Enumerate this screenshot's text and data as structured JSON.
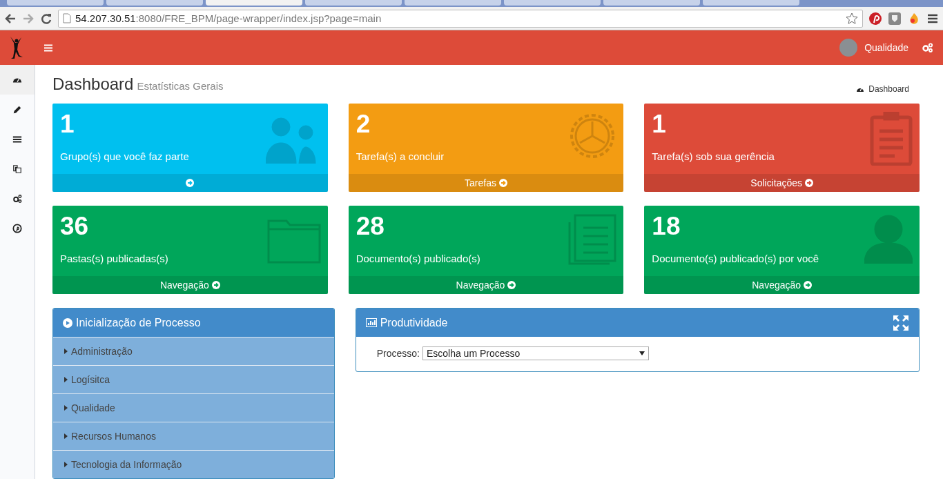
{
  "browser": {
    "tabs": [
      {
        "selected": false
      },
      {
        "selected": false
      },
      {
        "selected": true
      },
      {
        "selected": false
      },
      {
        "selected": false
      },
      {
        "selected": false
      },
      {
        "selected": false
      },
      {
        "selected": false
      }
    ],
    "url_host": "54.207.30.51",
    "url_rest": ":8080/FRE_BPM/page-wrapper/index.jsp?page=main"
  },
  "header": {
    "user": "Qualidade"
  },
  "sidebar": {
    "items": [
      {
        "selected": true
      },
      {
        "selected": false
      },
      {
        "selected": false
      },
      {
        "selected": false
      },
      {
        "selected": false
      },
      {
        "selected": false
      }
    ]
  },
  "page": {
    "title": "Dashboard",
    "subtitle": "Estatísticas Gerais",
    "breadcrumb": "Dashboard"
  },
  "cards": [
    {
      "number": "1",
      "label": "Grupo(s) que você faz parte",
      "color": "#00c0ef"
    },
    {
      "number": "2",
      "label": "Tarefa(s) a concluir",
      "footer": "Tarefas",
      "color": "#f39c12"
    },
    {
      "number": "1",
      "label": "Tarefa(s) sob sua gerência",
      "footer": "Solicitações",
      "color": "#dd4b39"
    },
    {
      "number": "36",
      "label": "Pastas(s) publicadas(s)",
      "footer": "Navegação",
      "color": "#00a65a"
    },
    {
      "number": "28",
      "label": "Documento(s) publicado(s)",
      "footer": "Navegação",
      "color": "#00a65a"
    },
    {
      "number": "18",
      "label": "Documento(s) publicado(s) por você",
      "footer": "Navegação",
      "color": "#00a65a"
    }
  ],
  "process_panel": {
    "title": "Inicialização de Processo",
    "items": [
      {
        "label": "Administração",
        "expanded": false
      },
      {
        "label": "Logísitca",
        "expanded": false
      },
      {
        "label": "Qualidade",
        "expanded": false
      },
      {
        "label": "Recursos Humanos",
        "expanded": false
      },
      {
        "label": "Tecnologia da Informação",
        "expanded": false
      }
    ]
  },
  "productivity_panel": {
    "title": "Produtividade",
    "field_label": "Processo:",
    "select_value": "Escolha um Processo"
  }
}
